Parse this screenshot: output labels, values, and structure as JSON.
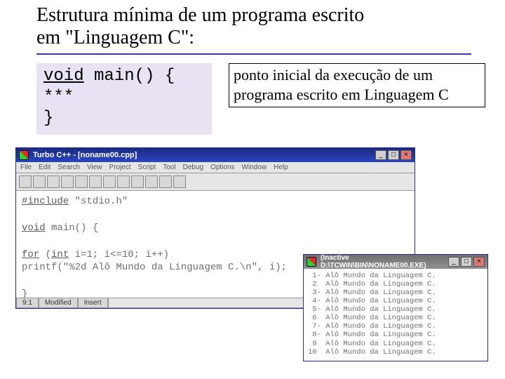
{
  "title_line1": "Estrutura mínima de um programa escrito",
  "title_line2": "em \"Linguagem C\":",
  "codebox": {
    "l1a": "void",
    "l1b": " main() {",
    "l2": "   ***",
    "l3": "}"
  },
  "callout_l1": "ponto inicial da execução de um",
  "callout_l2": "programa escrito em Linguagem C",
  "ide": {
    "title": "Turbo C++  -  [noname00.cpp]",
    "menu": [
      "File",
      "Edit",
      "Search",
      "View",
      "Project",
      "Script",
      "Tool",
      "Debug",
      "Options",
      "Window",
      "Help"
    ],
    "editor": {
      "l1a": "#include",
      "l1b": " \"stdio.h\"",
      "l3a": "void",
      "l3b": " main() {",
      "l5a": "  for",
      "l5b": " (",
      "l5c": "int",
      "l5d": " i=1; i<=10; i++)",
      "l6": "    printf(\"%2d  Alô Mundo da Linguagem C.\\n\", i);",
      "l8": "}"
    },
    "status": {
      "pos": "9:1",
      "mod": "Modified",
      "ins": "Insert"
    }
  },
  "console": {
    "title": "(Inactive D:\\TCWIN\\BIN\\NONAME00.EXE)",
    "lines": [
      " 1- Alô Mundo da Linguagem C.",
      " 2  Alô Mundo da Linguagem C.",
      " 3- Alô Mundo da Linguagem C.",
      " 4- Alô Mundo da Linguagem C.",
      " 5- Alô Mundo da Linguagem C.",
      " 6  Alô Mundo da Linguagem C.",
      " 7- Alô Mundo da Linguagem C.",
      " 8- Alô Mundo da Linguagem C.",
      " 9  Alô Mundo da Linguagem C.",
      "10  Alô Mundo da Linguagem C."
    ]
  }
}
